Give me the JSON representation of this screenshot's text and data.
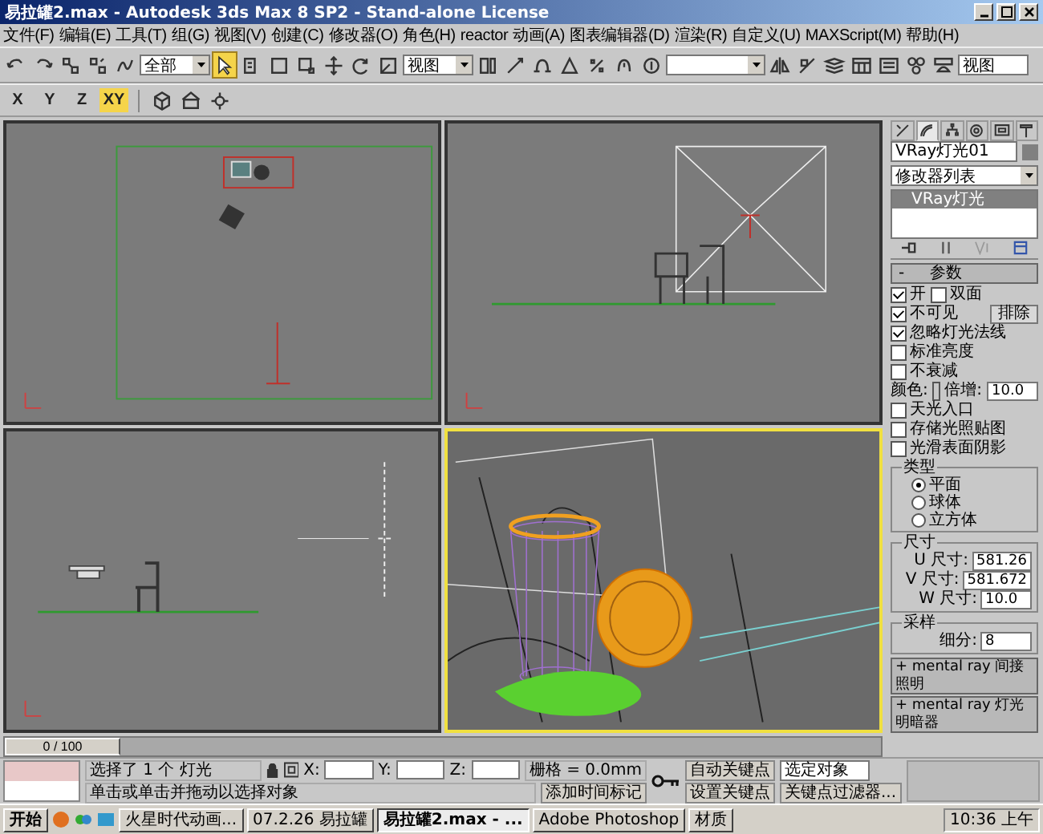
{
  "window": {
    "title": "易拉罐2.max - Autodesk 3ds Max 8 SP2  - Stand-alone License"
  },
  "menu": [
    "文件(F)",
    "编辑(E)",
    "工具(T)",
    "组(G)",
    "视图(V)",
    "创建(C)",
    "修改器(O)",
    "角色(H)",
    "reactor",
    "动画(A)",
    "图表编辑器(D)",
    "渲染(R)",
    "自定义(U)",
    "MAXScript(M)",
    "帮助(H)"
  ],
  "main_toolbar": {
    "selection_filter": "全部",
    "select_tool": {
      "selected": true
    },
    "reference_coord": "视图",
    "render_preset": "视图"
  },
  "axis_buttons": [
    {
      "label": "X",
      "selected": false
    },
    {
      "label": "Y",
      "selected": false
    },
    {
      "label": "Z",
      "selected": false
    },
    {
      "label": "XY",
      "selected": true
    }
  ],
  "viewports": [
    {
      "kind": "top",
      "selected": false
    },
    {
      "kind": "front",
      "selected": false
    },
    {
      "kind": "left",
      "selected": false
    },
    {
      "kind": "perspective",
      "selected": true
    }
  ],
  "command_panel": {
    "tabs": [
      {
        "kind": "create",
        "selected": false
      },
      {
        "kind": "modify",
        "selected": true
      },
      {
        "kind": "hierarchy",
        "selected": false
      },
      {
        "kind": "motion",
        "selected": false
      },
      {
        "kind": "display",
        "selected": false
      },
      {
        "kind": "utilities",
        "selected": false
      }
    ],
    "object_name": "VRay灯光01",
    "modifier_list": "修改器列表",
    "stack": [
      {
        "label": "VRay灯光",
        "selected": true
      }
    ],
    "rollout_toggle": "-",
    "rollout_title": "参数",
    "checks_top": [
      {
        "label": "开",
        "checked": true
      },
      {
        "label": "双面",
        "checked": false
      }
    ],
    "exclude_button": "排除",
    "checks": [
      {
        "label": "不可见",
        "checked": true
      },
      {
        "label": "忽略灯光法线",
        "checked": true
      },
      {
        "label": "标准亮度",
        "checked": false
      },
      {
        "label": "不衰减",
        "checked": false
      }
    ],
    "color_label": "颜色:",
    "multiplier_label": "倍增:",
    "multiplier": "10.0",
    "checks2": [
      {
        "label": "天光入口",
        "checked": false
      },
      {
        "label": "存储光照贴图",
        "checked": false
      },
      {
        "label": "光滑表面阴影",
        "checked": false
      }
    ],
    "type_group": {
      "title": "类型",
      "options": [
        {
          "label": "平面",
          "selected": true
        },
        {
          "label": "球体",
          "selected": false
        },
        {
          "label": "立方体",
          "selected": false
        }
      ]
    },
    "size_group": {
      "title": "尺寸",
      "fields": [
        {
          "label": "U 尺寸:",
          "value": "581.26"
        },
        {
          "label": "V 尺寸:",
          "value": "581.672"
        },
        {
          "label": "W 尺寸:",
          "value": "10.0"
        }
      ]
    },
    "sampling_group": {
      "title": "采样",
      "fields": [
        {
          "label": "细分:",
          "value": "8"
        }
      ]
    },
    "rollouts": [
      "+ mental ray 间接照明",
      "+ mental ray 灯光明暗器"
    ]
  },
  "time_slider": {
    "label": "0 / 100",
    "level": 0
  },
  "status": {
    "selection": "选择了 1 个 灯光",
    "prompt": "单击或单击并拖动以选择对象",
    "x_label": "X:",
    "y_label": "Y:",
    "z_label": "Z:",
    "grid": "栅格 = 0.0mm",
    "add_time_tag": "添加时间标记",
    "auto_key": "自动关键点",
    "key_mode": "选定对象",
    "set_key": "设置关键点",
    "key_filters": "关键点过滤器..."
  },
  "taskbar": {
    "start": "开始",
    "items": [
      {
        "label": "火星时代动画...",
        "selected": false
      },
      {
        "label": "07.2.26 易拉罐",
        "selected": false
      },
      {
        "label": "易拉罐2.max - ...",
        "selected": true
      },
      {
        "label": "Adobe Photoshop",
        "selected": false
      },
      {
        "label": "材质",
        "selected": false
      }
    ],
    "clock": "10:36 上午"
  }
}
